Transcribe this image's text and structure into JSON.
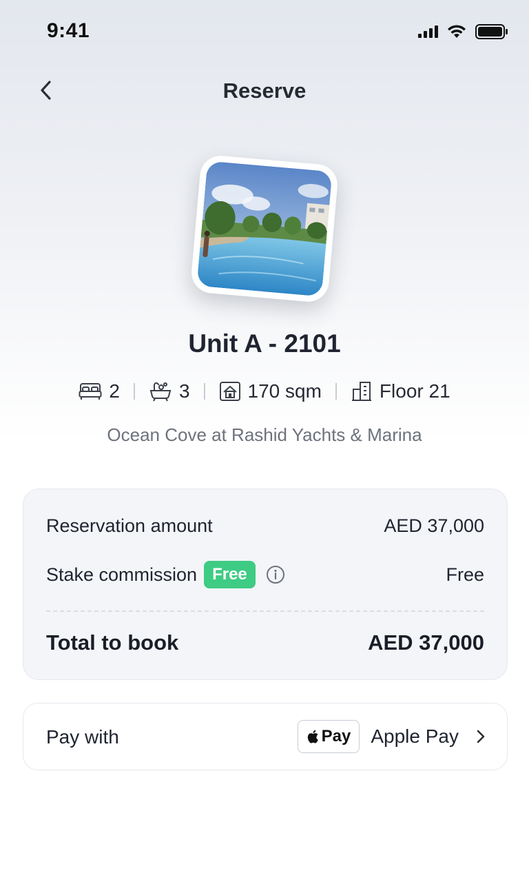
{
  "status_bar": {
    "time": "9:41"
  },
  "nav": {
    "title": "Reserve"
  },
  "unit": {
    "title": "Unit A - 2101",
    "bedrooms": "2",
    "bathrooms": "3",
    "area": "170 sqm",
    "floor": "Floor 21",
    "location": "Ocean Cove at Rashid Yachts & Marina"
  },
  "summary": {
    "reservation_label": "Reservation amount",
    "reservation_value": "AED 37,000",
    "commission_label": "Stake commission",
    "commission_badge": "Free",
    "commission_value": "Free",
    "total_label": "Total to book",
    "total_value": "AED 37,000"
  },
  "payment": {
    "label": "Pay with",
    "badge_text": "Pay",
    "method": "Apple Pay"
  },
  "colors": {
    "accent_green": "#3ecb84",
    "card_bg": "#f3f5f8",
    "text_primary": "#1f2430",
    "text_muted": "#6d727c"
  }
}
